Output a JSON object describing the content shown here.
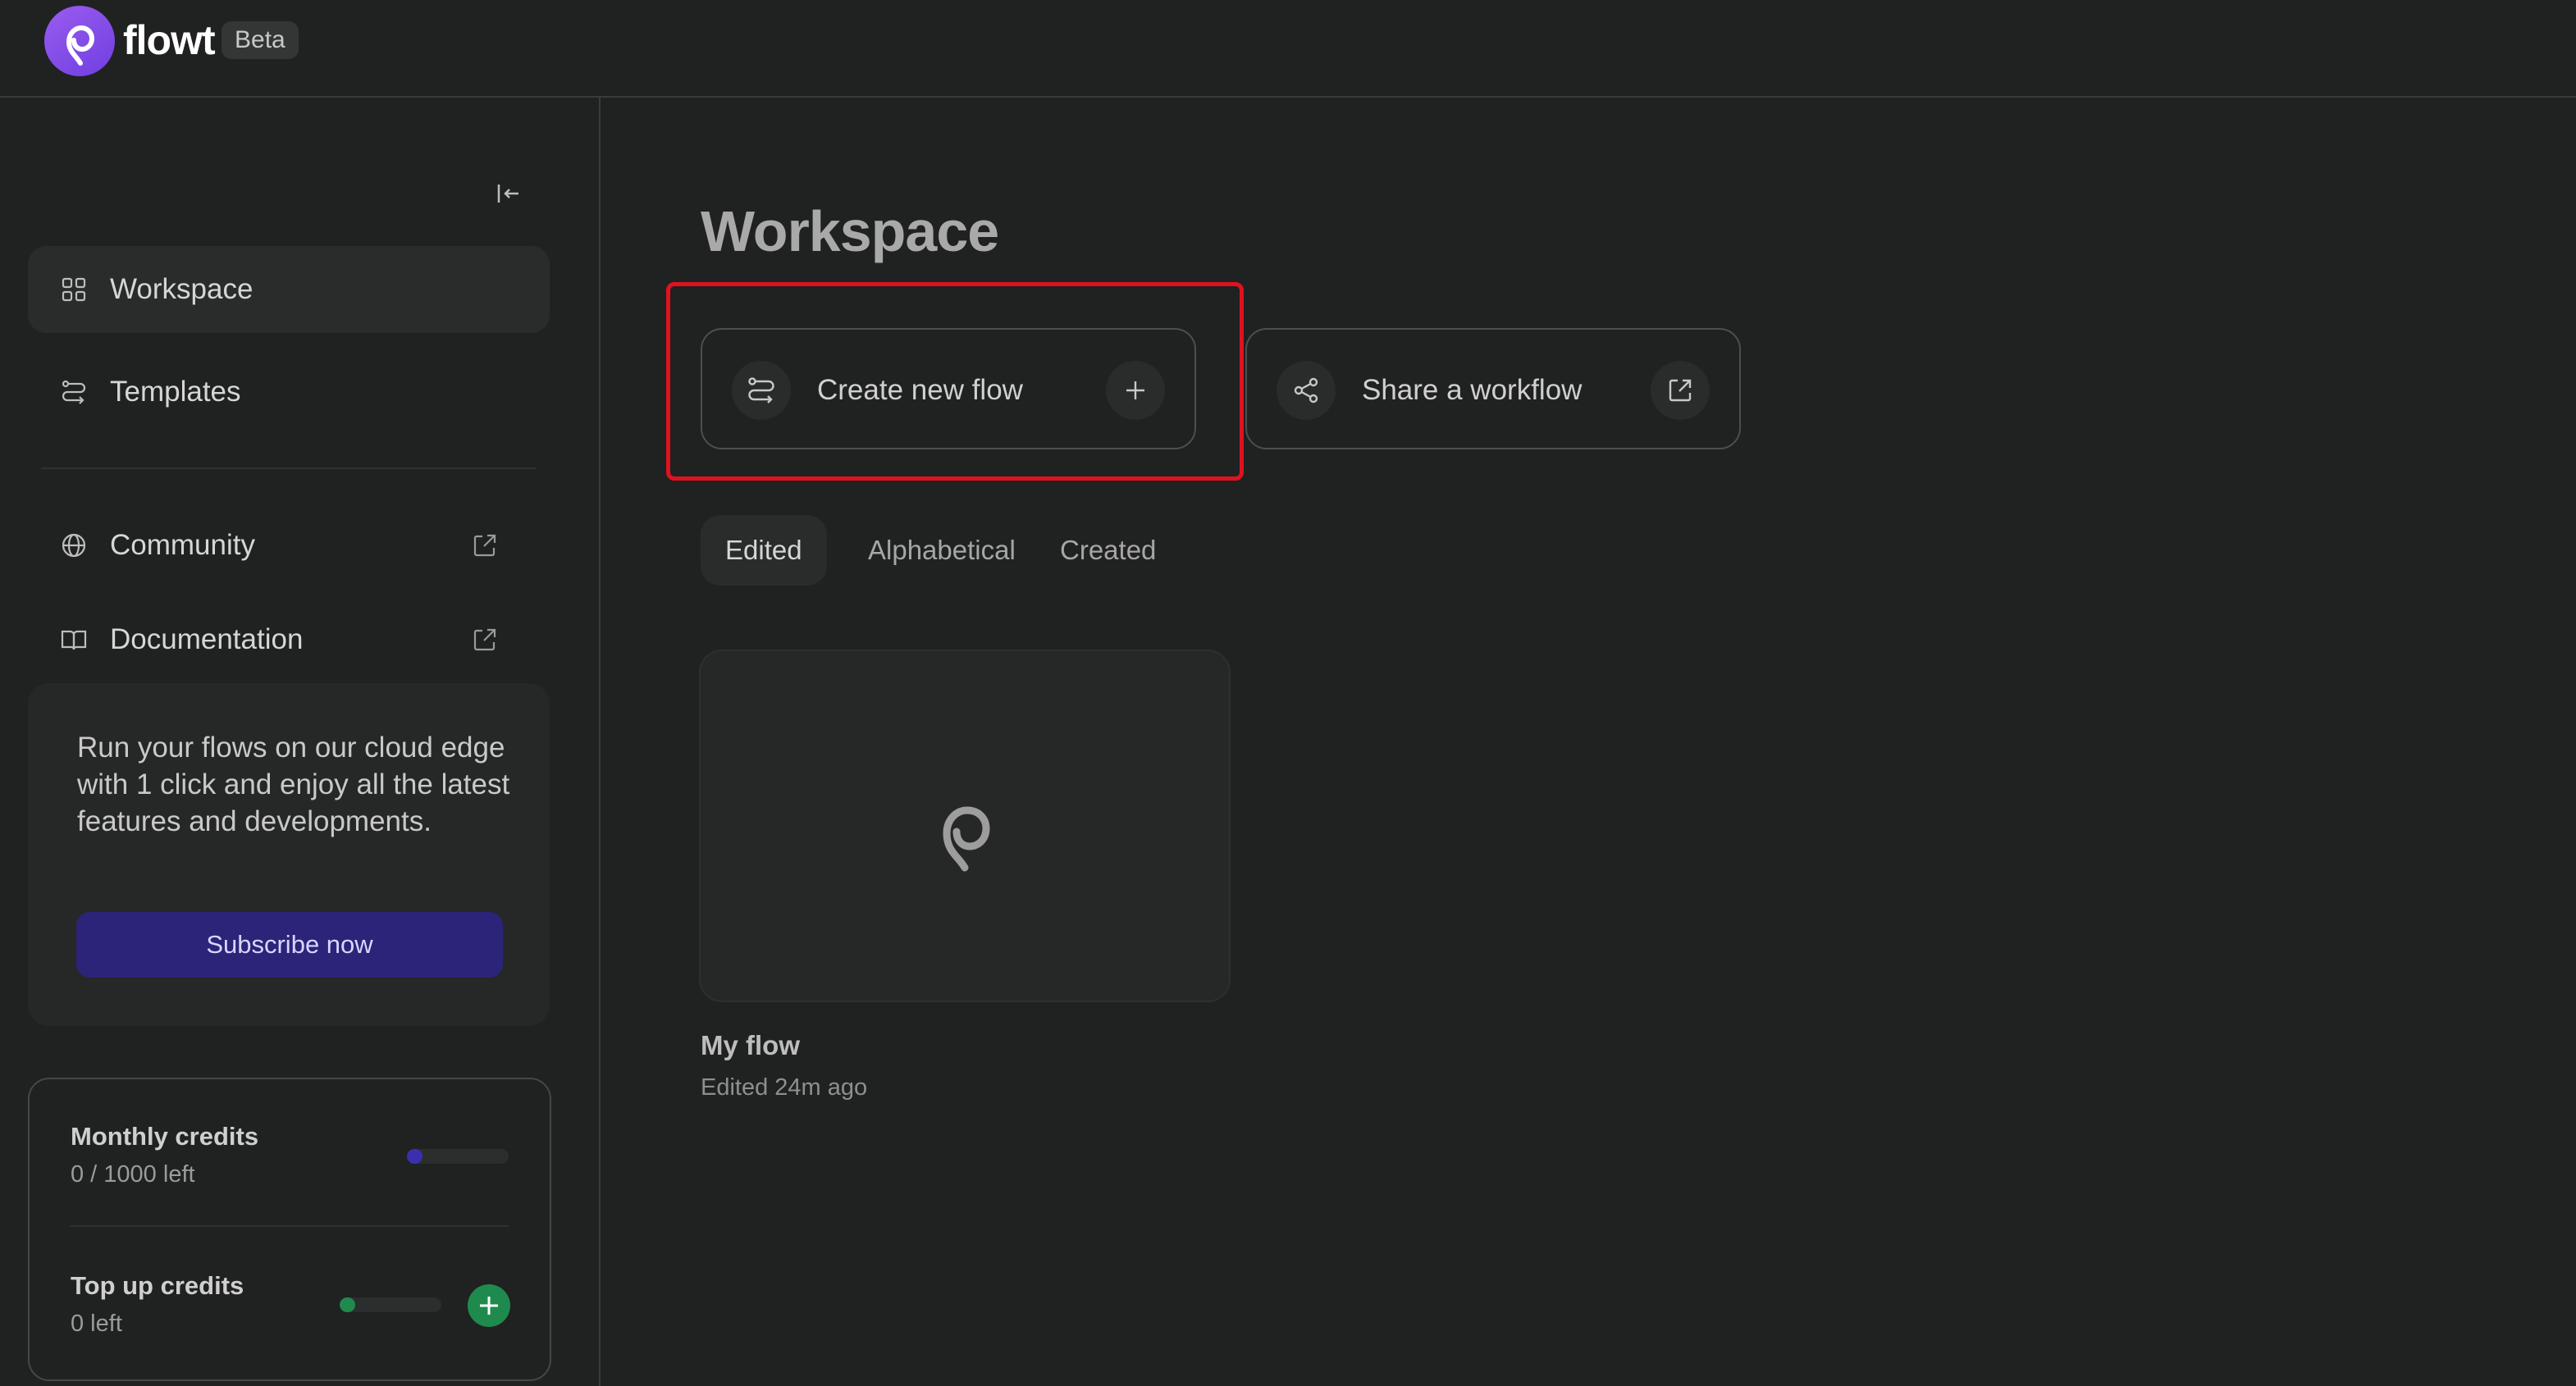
{
  "header": {
    "brand": "flowt",
    "badge": "Beta"
  },
  "sidebar": {
    "items": [
      {
        "label": "Workspace",
        "icon": "grid-icon",
        "active": true
      },
      {
        "label": "Templates",
        "icon": "route-icon",
        "active": false
      },
      {
        "label": "Community",
        "icon": "globe-icon",
        "external": true
      },
      {
        "label": "Documentation",
        "icon": "book-icon",
        "external": true
      }
    ],
    "promo": {
      "text": "Run your flows on our cloud edge with 1 click and enjoy all the latest features and developments.",
      "button_label": "Subscribe now"
    },
    "credits": {
      "monthly_title": "Monthly credits",
      "monthly_value": "0 / 1000 left",
      "monthly_fraction": 0.0,
      "topup_title": "Top up credits",
      "topup_value": "0 left",
      "topup_fraction": 0.0,
      "monthly_color": "#3b2fb0",
      "topup_color": "#1f8a4d"
    }
  },
  "main": {
    "title": "Workspace",
    "actions": {
      "create_label": "Create new flow",
      "share_label": "Share a workflow"
    },
    "sort_tabs": [
      {
        "label": "Edited",
        "active": true
      },
      {
        "label": "Alphabetical",
        "active": false
      },
      {
        "label": "Created",
        "active": false
      }
    ],
    "flows": [
      {
        "name": "My flow",
        "edited": "Edited 24m ago"
      }
    ]
  },
  "colors": {
    "background": "#202121",
    "accent": "#7c4dea",
    "highlight": "#e0121f"
  }
}
